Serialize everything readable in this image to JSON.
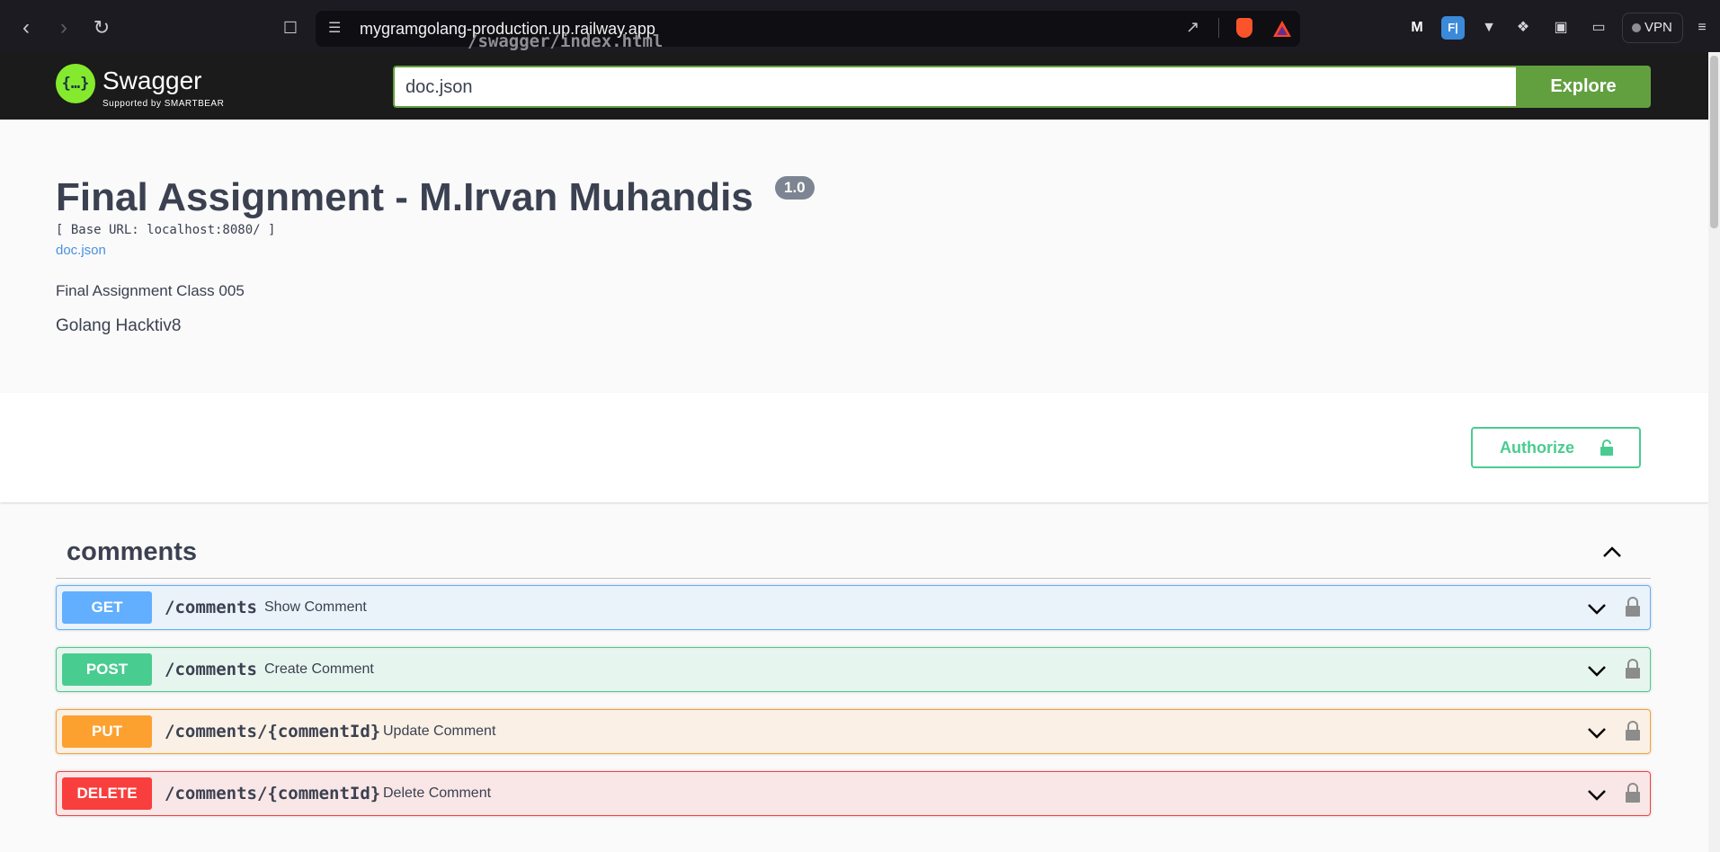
{
  "browser": {
    "url_host": "mygramgolang-production.up.railway.app",
    "url_path": "/swagger/index.html",
    "vpn_label": "VPN"
  },
  "topbar": {
    "logo_text": "Swagger",
    "logo_sub": "Supported by SMARTBEAR",
    "search_value": "doc.json",
    "explore_label": "Explore"
  },
  "info": {
    "title": "Final Assignment - M.Irvan Muhandis",
    "version": "1.0",
    "base_url": "[ Base URL: localhost:8080/ ]",
    "doc_link": "doc.json",
    "description_line1": "Final Assignment Class 005",
    "description_line2": "Golang Hacktiv8"
  },
  "scheme": {
    "authorize_label": "Authorize"
  },
  "tag": {
    "name": "comments",
    "operations": [
      {
        "method": "GET",
        "path": "/comments",
        "summary": "Show Comment"
      },
      {
        "method": "POST",
        "path": "/comments",
        "summary": "Create Comment"
      },
      {
        "method": "PUT",
        "path": "/comments/{commentId}",
        "summary": "Update Comment"
      },
      {
        "method": "DELETE",
        "path": "/comments/{commentId}",
        "summary": "Delete Comment"
      }
    ]
  },
  "colors": {
    "get": "#61affe",
    "post": "#49cc90",
    "put": "#fca130",
    "delete": "#f93e3e",
    "swagger_green": "#62a03f",
    "topbar_bg": "#1b1b1b"
  }
}
